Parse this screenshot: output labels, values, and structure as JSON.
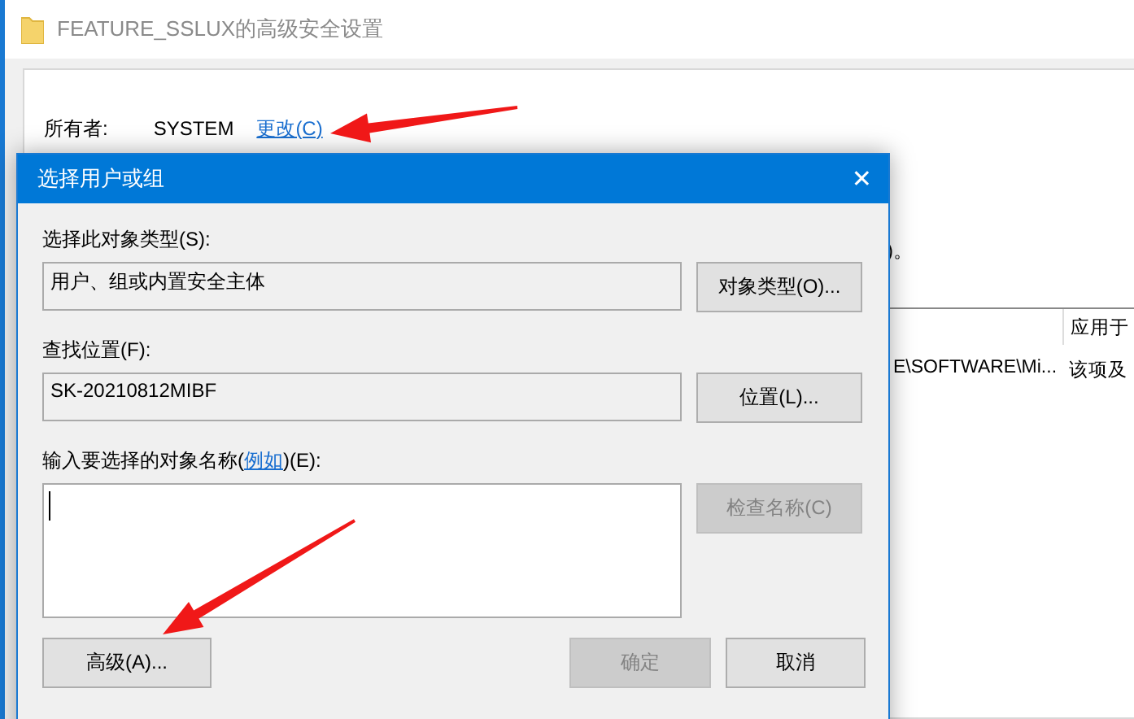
{
  "background_window": {
    "title": "FEATURE_SSLUX的高级安全设置",
    "owner_label": "所有者:",
    "owner_value": "SYSTEM",
    "change_link": "更改(C)",
    "partial_text": ")。",
    "table": {
      "column_2_header": "应用于",
      "rows": [
        {
          "column_1": "E\\SOFTWARE\\Mi...",
          "column_2": "该项及"
        }
      ]
    }
  },
  "dialog": {
    "title": "选择用户或组",
    "close": "✕",
    "object_type_label": "选择此对象类型(S):",
    "object_type_value": "用户、组或内置安全主体",
    "object_type_button": {
      "label": "对象类型(O)...",
      "disabled": false
    },
    "location_label": "查找位置(F):",
    "location_value": "SK-20210812MIBF",
    "location_button": {
      "label": "位置(L)...",
      "disabled": false
    },
    "names_label_before": "输入要选择的对象名称(",
    "example_link": "例如",
    "names_label_after": ")(E):",
    "check_names_button": {
      "label": "检查名称(C)",
      "disabled": true
    },
    "advanced_button": {
      "label": "高级(A)...",
      "disabled": false
    },
    "ok_button": {
      "label": "确定",
      "disabled": true
    },
    "cancel_button": {
      "label": "取消",
      "disabled": false
    }
  }
}
